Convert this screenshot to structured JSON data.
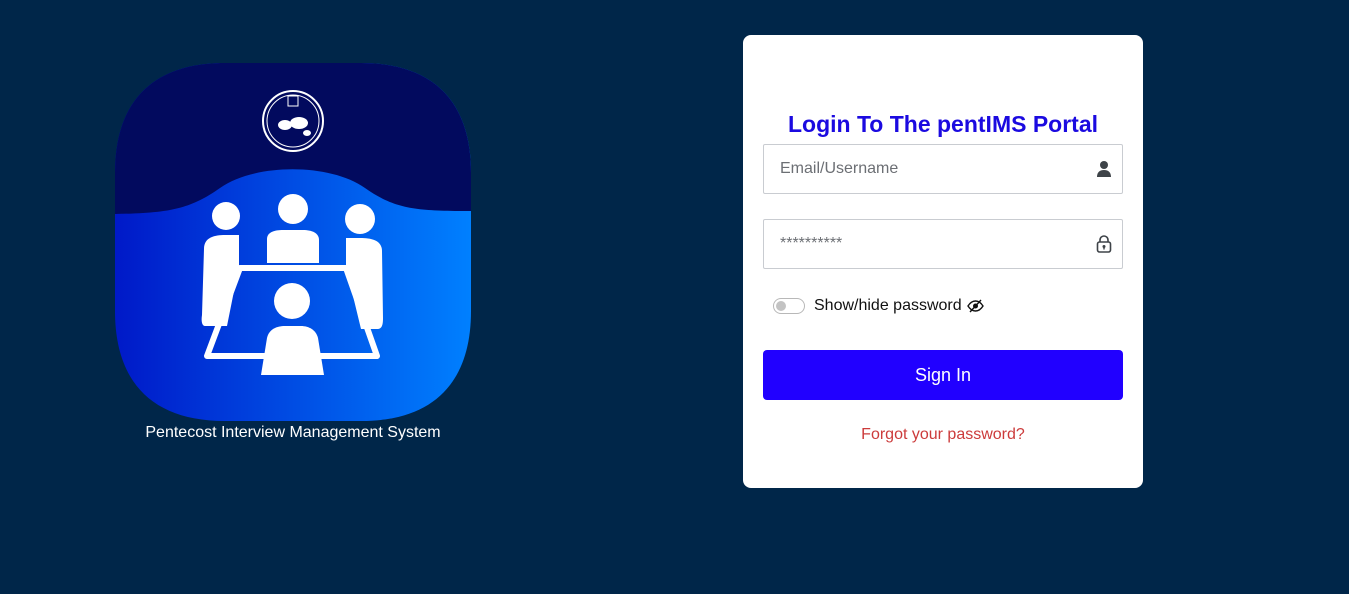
{
  "brand": {
    "caption": "Pentecost Interview Management System",
    "logo_icon": "meeting-table-icon",
    "emblem_icon": "world-map-emblem-icon",
    "colors": {
      "logo_top": "#020a5e",
      "logo_gradient_start": "#0019c8",
      "logo_gradient_end": "#0080ff"
    }
  },
  "login": {
    "title": "Login To The pentIMS Portal",
    "email_placeholder": "Email/Username",
    "password_placeholder": "**********",
    "show_hide_label": "Show/hide password",
    "signin_label": "Sign In",
    "forgot_label": "Forgot your password?",
    "colors": {
      "title": "#1b0ae0",
      "button": "#2100ff",
      "forgot": "#cc3b3b",
      "page_background": "#002649"
    }
  }
}
